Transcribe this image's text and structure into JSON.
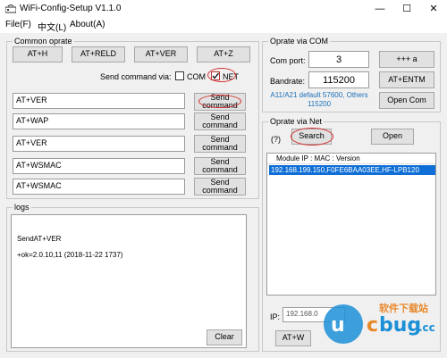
{
  "window": {
    "title": "WiFi-Config-Setup V1.1.0",
    "controls": {
      "minimize": "—",
      "maximize": "☐",
      "close": "✕"
    }
  },
  "menu": {
    "items": [
      "File(F)",
      "中文(L)",
      "About(A)"
    ]
  },
  "common": {
    "legend": "Common oprate",
    "buttons": [
      "AT+H",
      "AT+RELD",
      "AT+VER",
      "AT+Z"
    ],
    "send_via_label": "Send command via:",
    "com_label": "COM",
    "net_label": "NET",
    "com_checked": false,
    "net_checked": true,
    "commands": [
      {
        "value": "AT+VER",
        "button": "Send command"
      },
      {
        "value": "AT+WAP",
        "button": "Send command"
      },
      {
        "value": "AT+VER",
        "button": "Send command"
      },
      {
        "value": "AT+WSMAC",
        "button": "Send command"
      },
      {
        "value": "AT+WSMAC",
        "button": "Send command"
      }
    ]
  },
  "logs": {
    "legend": "logs",
    "lines": [
      "SendAT+VER",
      "+ok=2.0.10,11 (2018-11-22 1737)"
    ],
    "clear_button": "Clear"
  },
  "com": {
    "legend": "Oprate via COM",
    "port_label": "Com port:",
    "port_value": "3",
    "rate_label": "Bandrate:",
    "rate_value": "115200",
    "plus_button": "+++ a",
    "entm_button": "AT+ENTM",
    "note": "A11/A21 default 57600, Others 115200",
    "open_button": "Open Com"
  },
  "net": {
    "legend": "Oprate via Net",
    "help": "(?)",
    "search_button": "Search",
    "open_button": "Open",
    "list_header": "Module IP  :  MAC  :  Version",
    "rows": [
      "192.168.199.150,F0FE6BAA03EE,HF-LPB120"
    ],
    "ip_label": "IP:",
    "ip_value": "192.168.0",
    "bottom_button": "AT+W"
  },
  "colors": {
    "accent": "#0f6fd6",
    "highlight": "#d53030",
    "note_text": "#1a6fb8"
  },
  "watermark": {
    "brand": "ucbug.cc",
    "tagline": "软件下载站"
  }
}
